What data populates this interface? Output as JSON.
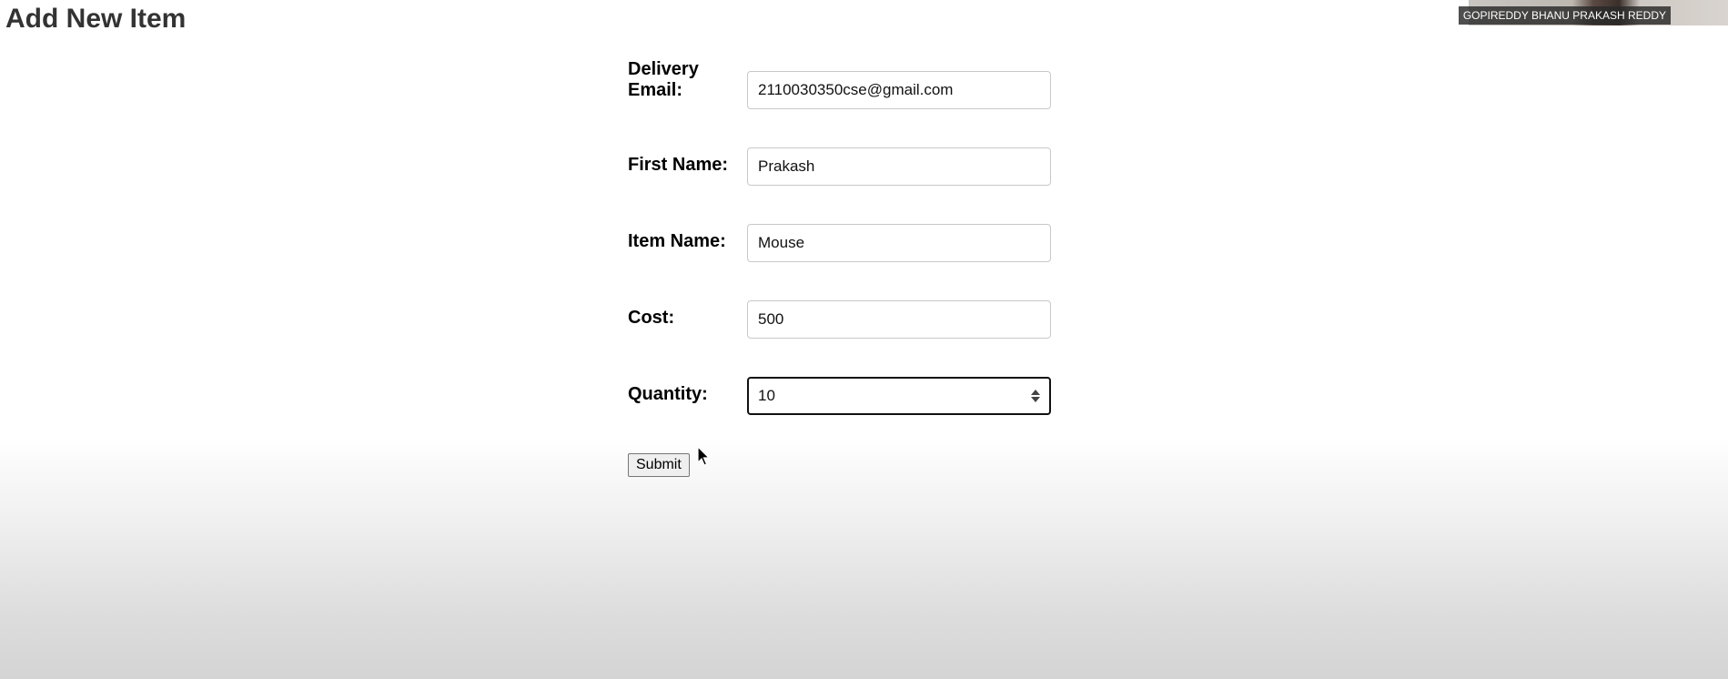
{
  "page": {
    "title": "Add New Item"
  },
  "video": {
    "participant_name": "GOPIREDDY BHANU PRAKASH REDDY"
  },
  "form": {
    "fields": [
      {
        "label": "Delivery Email:",
        "value": "2110030350cse@gmail.com",
        "type": "email"
      },
      {
        "label": "First Name:",
        "value": "Prakash",
        "type": "text"
      },
      {
        "label": "Item Name:",
        "value": "Mouse",
        "type": "text"
      },
      {
        "label": "Cost:",
        "value": "500",
        "type": "text"
      },
      {
        "label": "Quantity:",
        "value": "10",
        "type": "number",
        "focused": true
      }
    ],
    "submit_label": "Submit"
  },
  "icons": {
    "spinner": "number-spinner-icon",
    "cursor": "mouse-pointer-icon"
  }
}
